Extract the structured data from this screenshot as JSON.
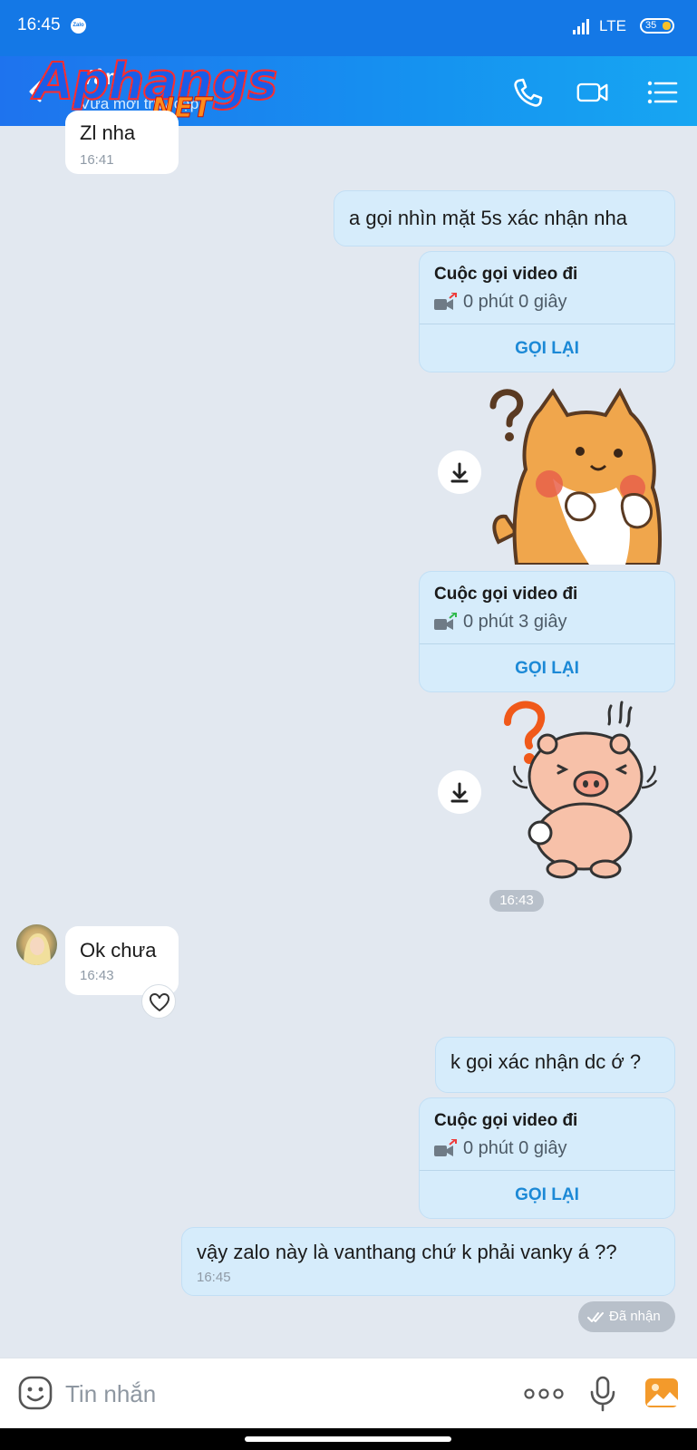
{
  "status_bar": {
    "time": "16:45",
    "app_badge": "Zalo",
    "network": "LTE",
    "battery": "35"
  },
  "header": {
    "contact_name": "Vân",
    "subtitle": "Vừa mới truy cập",
    "watermark_logo": "Aphangs .NET",
    "icons": [
      "back-arrow-icon",
      "phone-icon",
      "video-call-icon",
      "menu-list-icon"
    ]
  },
  "messages": {
    "m1": {
      "text": "Zl nha",
      "time": "16:41"
    },
    "m2": {
      "text": "a gọi nhìn mặt 5s xác nhận nha"
    },
    "call1": {
      "title": "Cuộc gọi video đi",
      "duration": "0 phút 0 giây",
      "action": "GỌI LẠI"
    },
    "call2": {
      "title": "Cuộc gọi video đi",
      "duration": "0 phút 3 giây",
      "action": "GỌI LẠI"
    },
    "time_chip": "16:43",
    "m3": {
      "text": "Ok chưa",
      "time": "16:43"
    },
    "m4": {
      "text": "k gọi xác nhận dc ớ ?"
    },
    "call3": {
      "title": "Cuộc gọi video đi",
      "duration": "0 phút 0 giây",
      "action": "GỌI LẠI"
    },
    "m5": {
      "text": "vậy zalo này là vanthang chứ k phải vanky á ??",
      "time": "16:45"
    },
    "status": "Đã nhận"
  },
  "input": {
    "placeholder": "Tin nhắn"
  },
  "colors": {
    "header_blue": "#1478e6",
    "outgoing_bubble": "#d6ecfb",
    "recall_blue": "#1c89d6",
    "background": "#e2e8f0"
  }
}
